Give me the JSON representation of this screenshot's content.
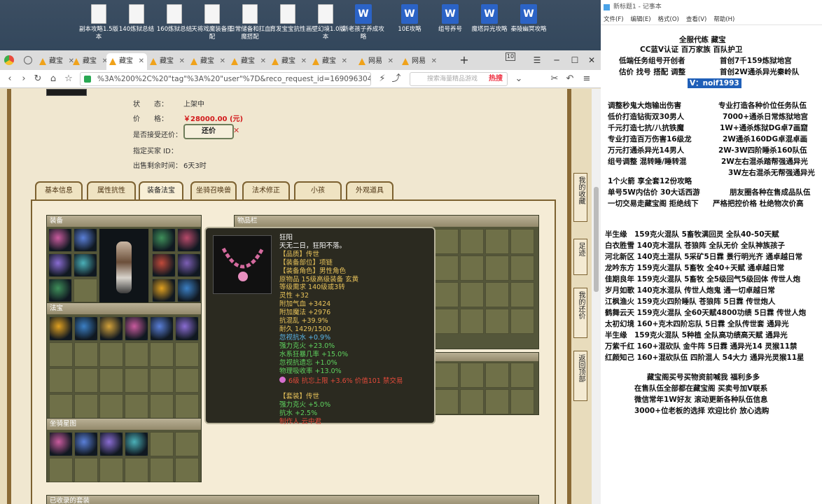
{
  "desktop_icons": [
    {
      "label": "副本攻略1.5版本",
      "type": "doc"
    },
    {
      "label": "140炼狱总结",
      "type": "doc"
    },
    {
      "label": "160炼狱总结",
      "type": "doc"
    },
    {
      "label": "天将戏魔装备搭配",
      "type": "doc"
    },
    {
      "label": "日常储备和扛血魔搭配",
      "type": "doc"
    },
    {
      "label": "育发宝宝抗性",
      "type": "doc"
    },
    {
      "label": "画壁幻境1.0版本",
      "type": "doc"
    },
    {
      "label": "新老孩子养成攻略",
      "type": "word"
    },
    {
      "label": "10E攻略",
      "type": "word"
    },
    {
      "label": "组号养号",
      "type": "word"
    },
    {
      "label": "魔塔异光攻略",
      "type": "word"
    },
    {
      "label": "秦陵幽冥攻略",
      "type": "word"
    }
  ],
  "browser": {
    "tabs": [
      "藏宝",
      "藏宝",
      "藏宝",
      "藏宝",
      "藏宝",
      "藏宝",
      "藏宝",
      "藏宝",
      "网易",
      "网易"
    ],
    "active_tab_index": 2,
    "tab_count_badge": "10",
    "url": "%3A%200%2C%20\"tag\"%3A%20\"user\"%7D&reco_request_id=1690963048027gDg6s",
    "search_placeholder": "搜索海量精品游戏",
    "hot_label": "热搜"
  },
  "listing": {
    "status_label": "状　　态：",
    "status_value": "上架中",
    "price_label": "价　　格：",
    "price_value": "￥28000.00 (元)",
    "haggle_label": "是否接受还价：",
    "haggle_button": "还价",
    "buyer_id_label": "指定买家 ID：",
    "remaining_label": "出售剩余时间：",
    "remaining_value": "6天3时"
  },
  "page_tabs": [
    "基本信息",
    "属性抗性",
    "装备法宝",
    "坐骑召唤兽",
    "法术修正",
    "小孩",
    "外观道具"
  ],
  "active_page_tab": 2,
  "sections": {
    "equipment": "装备",
    "treasures": "法宝",
    "inventory": "物品栏",
    "mount_ledger": "坐骑星图",
    "collected_sets": "已收录的套装"
  },
  "side_buttons": [
    "我的收藏",
    "足迹",
    "我的还价",
    "返回顶部"
  ],
  "tooltip": {
    "name": "狂阳",
    "desc": "天无二日，狂阳不落。",
    "quality": "【品质】传世",
    "slot": "【装备部位】项链",
    "role": "【装备角色】男性角色",
    "material": "原物品 15级高级装备 玄黄",
    "level": "等级需求 140级或3转",
    "spirit": "灵性 +32",
    "hp": "附加气血 +3424",
    "mana": "附加魔法 +2976",
    "chaos": "抗混乱 +39.9%",
    "durability": "耐久 1429/1500",
    "ignore_resist": "忽视抗水 +0.9%",
    "fire_power": "强力克火 +23.0%",
    "water_rage": "水系狂暴几率 +15.0%",
    "ignore_forget": "忽视抗遗忘 +1.0%",
    "phys_absorb": "物理吸收率 +13.0%",
    "gem": "6级 抗忘上限 +3.6% 价值101 禁交易",
    "set": "【套装】传世",
    "set_fire": "强力克火 +5.0%",
    "set_water": "抗水 +2.5%",
    "maker": "制作人 云中君"
  },
  "notepad": {
    "title": "新标题1 - 记事本",
    "menu": [
      "文件(F)",
      "编辑(E)",
      "格式(O)",
      "查看(V)",
      "帮助(H)"
    ],
    "lines": [
      "全服代练 藏宝",
      "CC蓝V认证 百万家族 百队护卫",
      "低端任务组号开创者",
      "首创7千159炼狱地宫",
      "估价 找号 搭配 调整",
      "首创2W通杀异光秦岭队",
      "V：noif1993",
      "调整秒鬼大炮输出伤害",
      "专业打造各种价位任务队伍",
      "低价打造钻街双30男人",
      "7000+通杀日常炼狱地宫",
      "千元打造七抗/八抗铁魔",
      "1W+通杀炼狱DG卓7画窟",
      "专业打造百万伤害16级龙",
      "2W通杀160DG卓混卓画",
      "万元打通杀异光14男人",
      "2W-3W四阶睡杀160队伍",
      "组号调整 混转睡/睡转混",
      "2W左右混杀踏帮强通异光",
      "3W左右混杀无帮强通异光",
      "1个火箭 享全套12份攻略",
      "单号5W内估价 30大话西游",
      "朋友圈各种在售成品队伍",
      "一切交易走藏宝阁 拒绝线下",
      "严格把控价格 杜绝物次价高",
      "半生缘　159克火混队 5畜牧满回灵 全队40-50天赋",
      "白衣胜雪 140克木混队 苍狼阵 全队无价 全队神族孩子",
      "河北新区 140克土混队 5采矿5日霖 景行明光齐 通卓越日常",
      "龙吟东方 159克火混队 5畜牧 全40+天赋 通卓越日常",
      "佳期良年 159克火混队 5畜牧 全5级回气5级回体 传世人炮",
      "岁月如歌 140克水混队 传世人炮鬼 通一切卓越日常",
      "江枫渔火 159克火四阶睡队 苍狼阵 5日霖 传世炮人",
      "鹤舞云天 159克火混队 全60天赋4800功绩 5日霖 传世人炮",
      "太初幻境 160+克木四阶忘队 5日霖 全队传世套 通异光",
      "半生缘　159克火混队 5种植 全队高功绩高天赋 通异光",
      "万紫千红 160+混砍队 金牛阵 5日霖 通异光14 灵猴11禁",
      "红颜知己 160+混砍队伍 四阶混人 54大力 通异光灵猴11星",
      "藏宝阁买号买物资前喊我 福利多多",
      "在售队伍全部都在藏宝阁 买卖号加V联系",
      "微信常年1W好友 滚动更新各种队伍信息",
      "3000+位老板的选择 欢迎比价 放心选购"
    ]
  },
  "colors": {
    "price": "#d2191b",
    "gem_bullet": "#d66fcf",
    "highlight": "#1f5fb8",
    "frame": "#8a6a36"
  }
}
